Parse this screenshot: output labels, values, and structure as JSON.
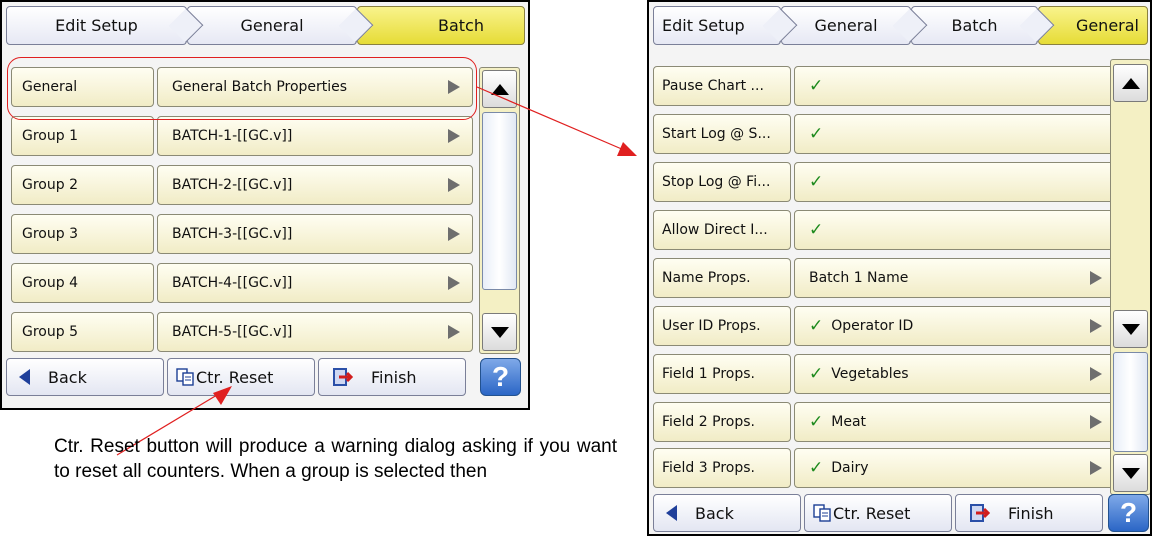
{
  "left_screen": {
    "breadcrumb": [
      "Edit Setup",
      "General",
      "Batch"
    ],
    "rows": [
      {
        "label": "General",
        "value": "General Batch Properties"
      },
      {
        "label": "Group 1",
        "value": "BATCH-1-[[GC.v]]"
      },
      {
        "label": "Group 2",
        "value": "BATCH-2-[[GC.v]]"
      },
      {
        "label": "Group 3",
        "value": "BATCH-3-[[GC.v]]"
      },
      {
        "label": "Group 4",
        "value": "BATCH-4-[[GC.v]]"
      },
      {
        "label": "Group 5",
        "value": "BATCH-5-[[GC.v]]"
      }
    ],
    "footer": {
      "back": "Back",
      "reset": "Ctr. Reset",
      "finish": "Finish",
      "help": "?"
    }
  },
  "right_screen": {
    "breadcrumb": [
      "Edit Setup",
      "General",
      "Batch",
      "General"
    ],
    "rows": [
      {
        "label": "Pause Chart ...",
        "value": ""
      },
      {
        "label": "Start Log @ S...",
        "value": ""
      },
      {
        "label": "Stop Log @ Fi...",
        "value": ""
      },
      {
        "label": "Allow Direct I...",
        "value": ""
      },
      {
        "label": "Name Props.",
        "value": "Batch 1 Name"
      },
      {
        "label": "User ID Props.",
        "value": "Operator ID"
      },
      {
        "label": "Field 1 Props.",
        "value": "Vegetables"
      },
      {
        "label": "Field 2 Props.",
        "value": "Meat"
      },
      {
        "label": "Field 3 Props.",
        "value": "Dairy"
      }
    ],
    "checked_rows": [
      0,
      1,
      2,
      3,
      5,
      6,
      7,
      8
    ],
    "arrow_rows": [
      4,
      5,
      6,
      7,
      8
    ],
    "footer": {
      "back": "Back",
      "reset": "Ctr. Reset",
      "finish": "Finish",
      "help": "?"
    }
  },
  "annotation": {
    "caption": "Ctr. Reset button will produce a warning dialog asking if you want to reset all counters. When a group is selected then"
  },
  "colors": {
    "active_crumb": "#f0e84a",
    "row_fill": "#f5f1d2",
    "highlight_oval": "#e02020",
    "checkmark": "#1d8a1d"
  }
}
